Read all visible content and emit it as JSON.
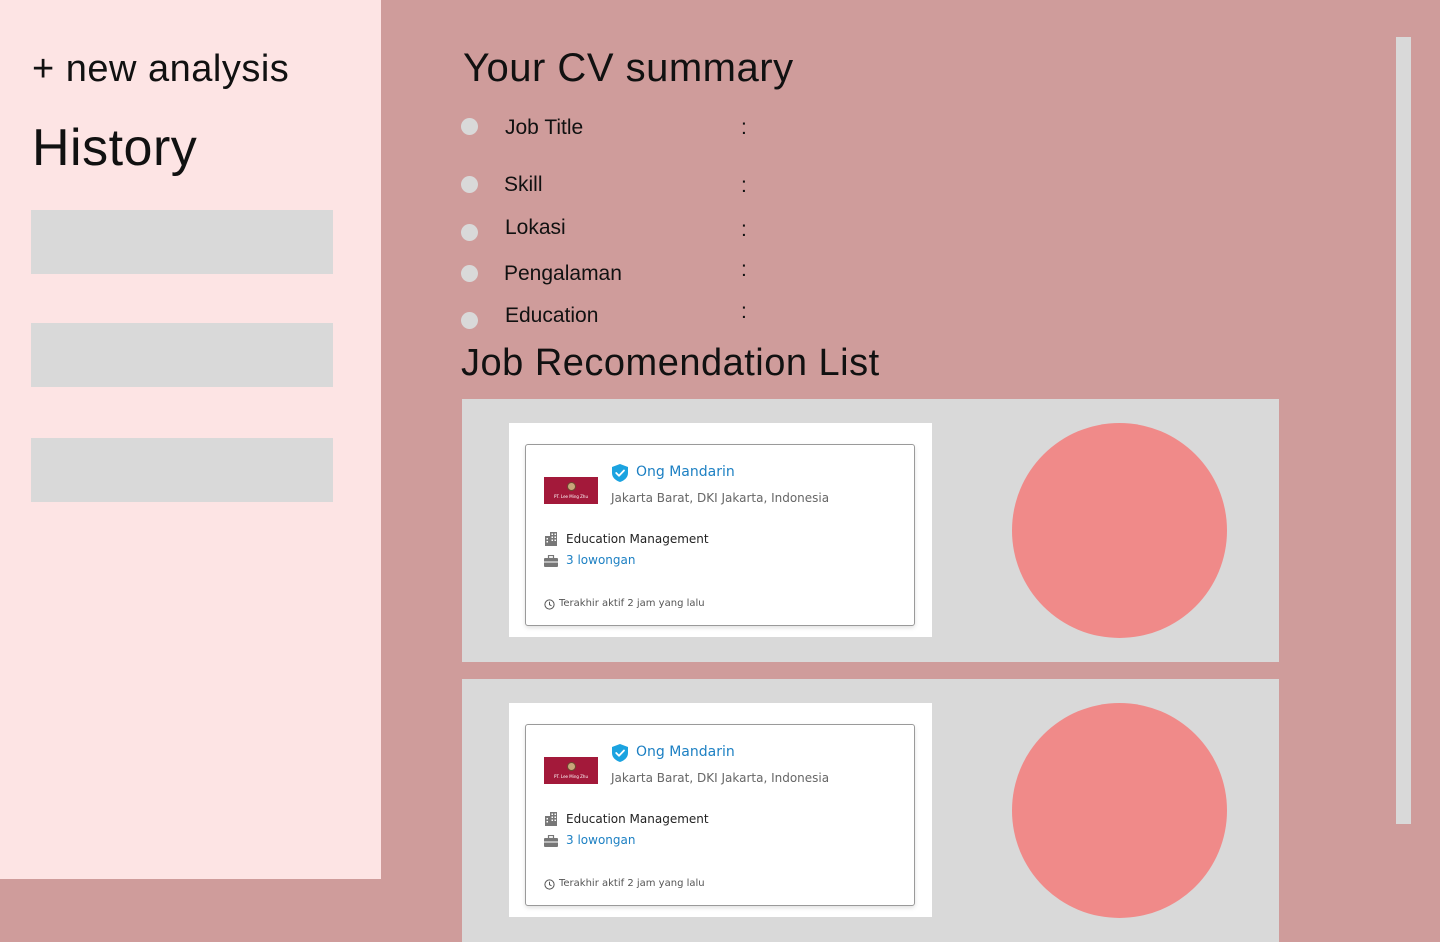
{
  "sidebar": {
    "new_analysis_label": "+ new analysis",
    "history_title": "History",
    "history_items": [
      "",
      "",
      ""
    ]
  },
  "cv_summary": {
    "title": "Your CV summary",
    "fields": [
      {
        "label": "Job Title",
        "value": ""
      },
      {
        "label": "Skill",
        "value": ""
      },
      {
        "label": "Lokasi",
        "value": ""
      },
      {
        "label": "Pengalaman",
        "value": ""
      },
      {
        "label": "Education",
        "value": ""
      }
    ],
    "separator": ":"
  },
  "job_list": {
    "title": "Job Recomendation List",
    "jobs": [
      {
        "company": "Ong Mandarin",
        "location": "Jakarta Barat, DKI Jakarta, Indonesia",
        "industry": "Education Management",
        "vacancies": "3 lowongan",
        "last_active": "Terakhir aktif 2 jam yang lalu",
        "logo_text": "PT. Lee Ming Zhu"
      },
      {
        "company": "Ong Mandarin",
        "location": "Jakarta Barat, DKI Jakarta, Indonesia",
        "industry": "Education Management",
        "vacancies": "3 lowongan",
        "last_active": "Terakhir aktif 2 jam yang lalu",
        "logo_text": "PT. Lee Ming Zhu"
      }
    ]
  },
  "icons": {
    "verified": "verified-shield-icon",
    "industry": "building-icon",
    "vacancy": "briefcase-icon",
    "last_active": "clock-icon"
  },
  "colors": {
    "sidebar_bg": "#fde4e4",
    "main_bg": "#cf9c9b",
    "placeholder": "#d9d9d9",
    "match_circle": "#f08a89",
    "link_blue": "#1d80c3",
    "logo_red": "#a3193a"
  }
}
